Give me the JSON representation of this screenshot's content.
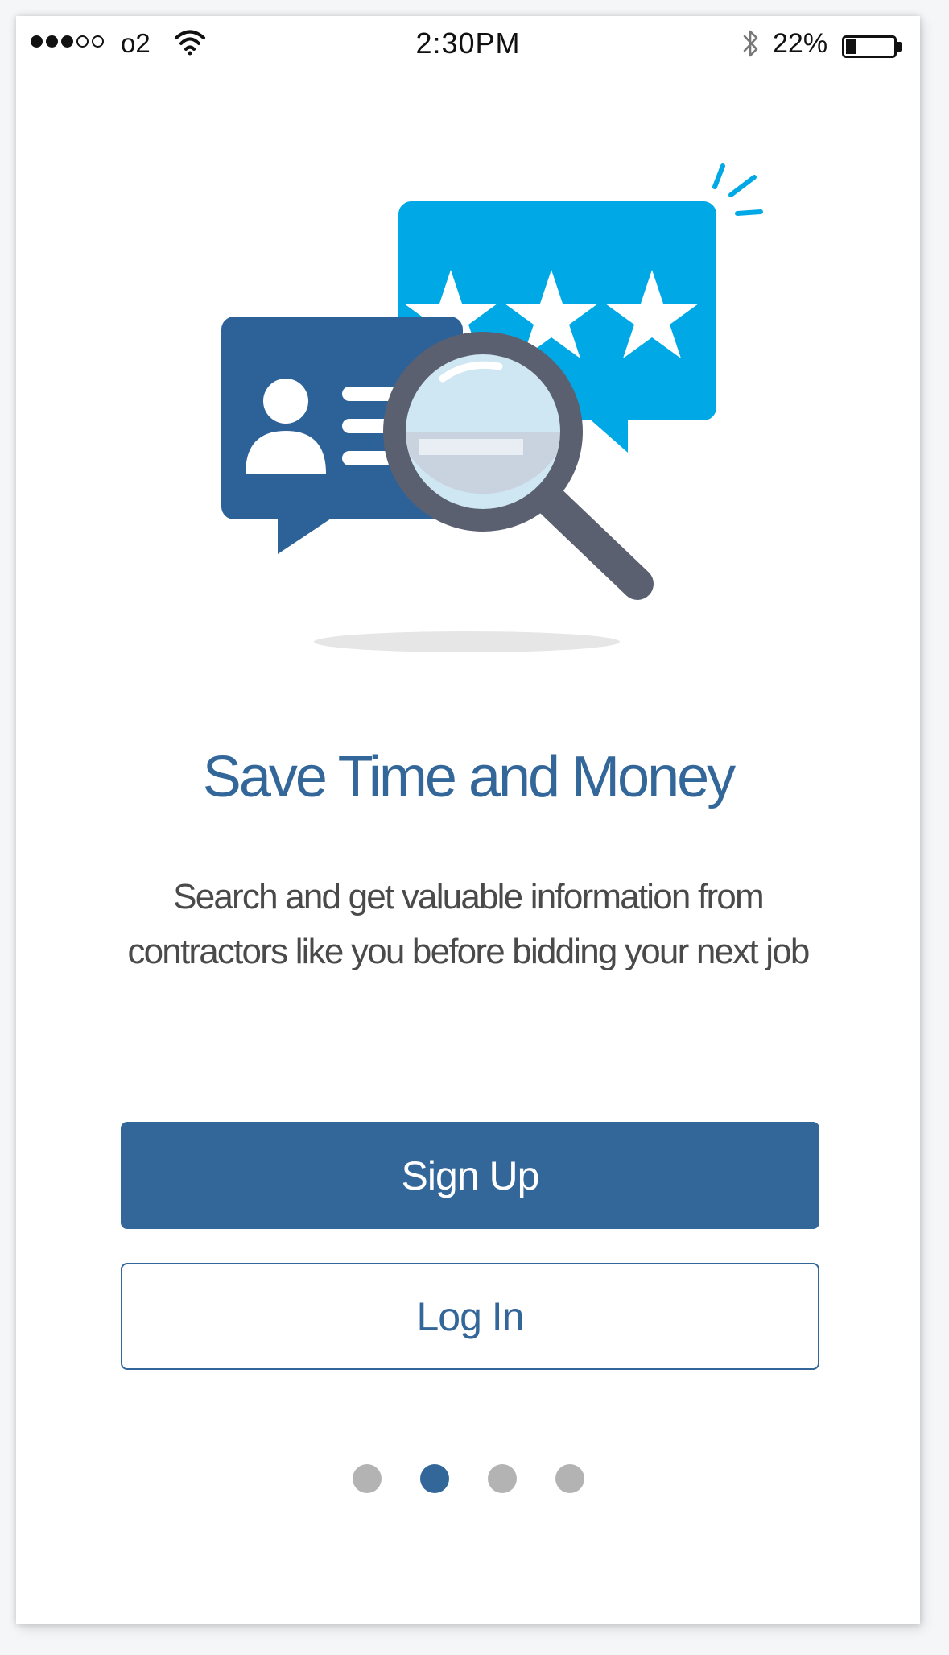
{
  "status_bar": {
    "carrier": "o2",
    "time": "2:30PM",
    "battery_percent": "22%",
    "signal_bars_filled": 3,
    "signal_bars_total": 5,
    "battery_level": 0.22,
    "icons": [
      "signal-icon",
      "wifi-icon",
      "bluetooth-icon",
      "battery-icon"
    ]
  },
  "illustration": {
    "icons": [
      "profile-card-icon",
      "rating-stars-icon",
      "magnifying-glass-icon"
    ],
    "star_count": 3
  },
  "onboarding": {
    "title": "Save Time and Money",
    "subtitle_line1": "Search and get valuable information from",
    "subtitle_line2": "contractors like you before bidding your next job"
  },
  "actions": {
    "signup_label": "Sign Up",
    "login_label": "Log In"
  },
  "pagination": {
    "total_pages": 4,
    "current_page": 2
  },
  "colors": {
    "brand_blue": "#336699",
    "light_blue": "#00a9e6",
    "card_blue": "#2d6299",
    "magnifier_gray": "#5a6070",
    "inactive_dot": "#b3b3b3"
  }
}
